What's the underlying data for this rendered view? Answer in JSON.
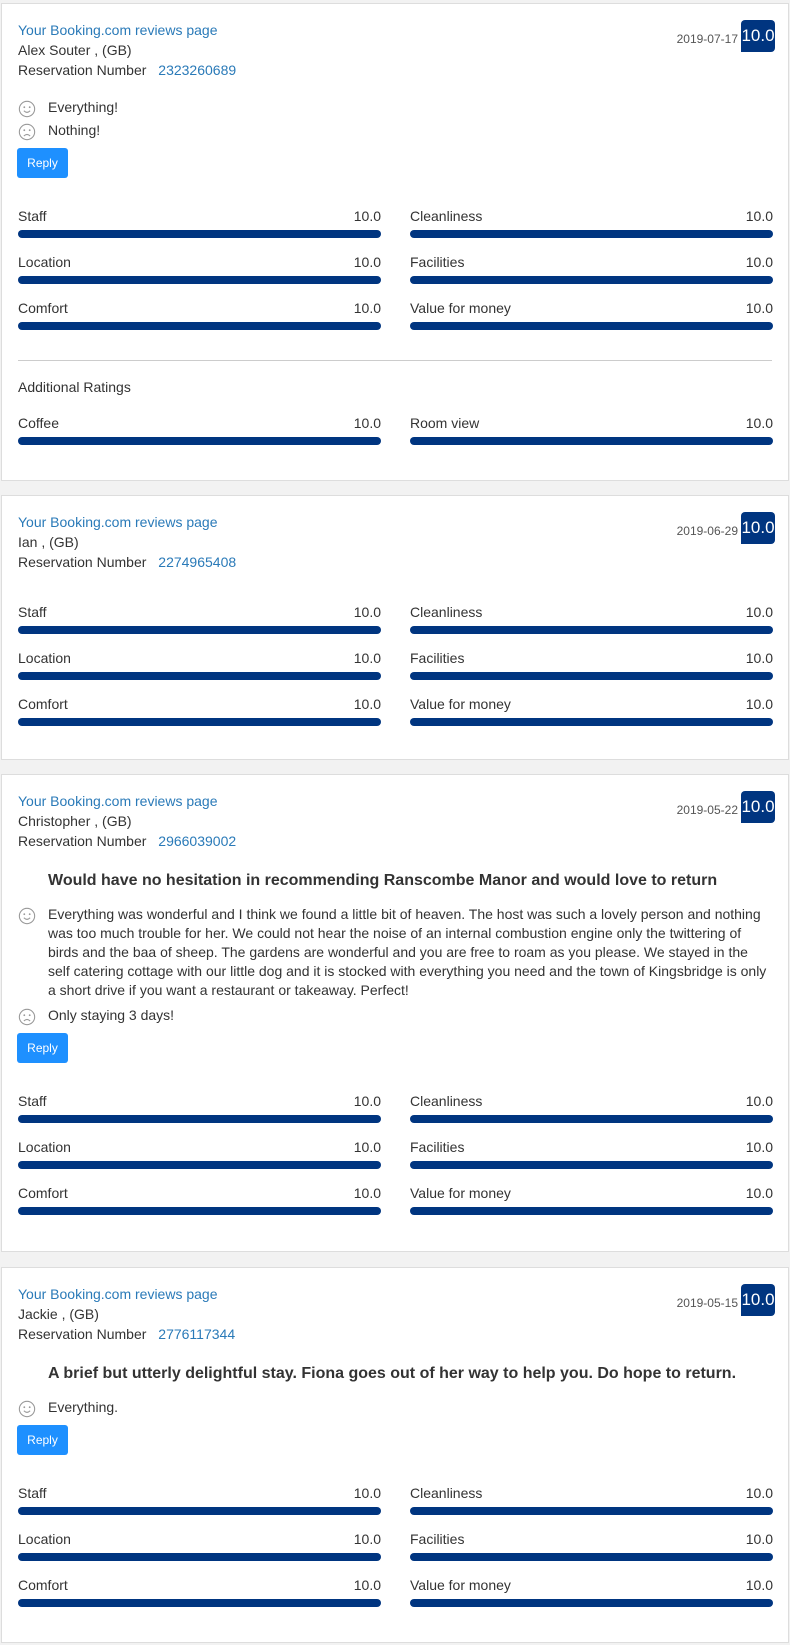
{
  "reviews_page_link": "Your Booking.com reviews page",
  "reservation_label": "Reservation Number",
  "reply_label": "Reply",
  "additional_ratings_title": "Additional Ratings",
  "colors": {
    "score_bg": "#003580",
    "bar_fill": "#003580",
    "link": "#2a7ab8",
    "reply_button": "#1e90ff"
  },
  "icons": {
    "positive": "smile-icon",
    "negative": "frown-icon"
  },
  "reviews": [
    {
      "guest": "Alex Souter , (GB)",
      "reservation_number": "2323260689",
      "date": "2019-07-17",
      "score": "10.0",
      "title": "",
      "positive": "Everything!",
      "negative": "Nothing!",
      "ratings": [
        {
          "label": "Staff",
          "value": "10.0",
          "fill_fraction": 1.0
        },
        {
          "label": "Cleanliness",
          "value": "10.0",
          "fill_fraction": 1.0
        },
        {
          "label": "Location",
          "value": "10.0",
          "fill_fraction": 1.0
        },
        {
          "label": "Facilities",
          "value": "10.0",
          "fill_fraction": 1.0
        },
        {
          "label": "Comfort",
          "value": "10.0",
          "fill_fraction": 1.0
        },
        {
          "label": "Value for money",
          "value": "10.0",
          "fill_fraction": 1.0
        }
      ],
      "additional_ratings": [
        {
          "label": "Coffee",
          "value": "10.0",
          "fill_fraction": 1.0
        },
        {
          "label": "Room view",
          "value": "10.0",
          "fill_fraction": 1.0
        }
      ]
    },
    {
      "guest": "Ian , (GB)",
      "reservation_number": "2274965408",
      "date": "2019-06-29",
      "score": "10.0",
      "title": "",
      "ratings": [
        {
          "label": "Staff",
          "value": "10.0",
          "fill_fraction": 1.0
        },
        {
          "label": "Cleanliness",
          "value": "10.0",
          "fill_fraction": 1.0
        },
        {
          "label": "Location",
          "value": "10.0",
          "fill_fraction": 1.0
        },
        {
          "label": "Facilities",
          "value": "10.0",
          "fill_fraction": 1.0
        },
        {
          "label": "Comfort",
          "value": "10.0",
          "fill_fraction": 1.0
        },
        {
          "label": "Value for money",
          "value": "10.0",
          "fill_fraction": 1.0
        }
      ]
    },
    {
      "guest": "Christopher , (GB)",
      "reservation_number": "2966039002",
      "date": "2019-05-22",
      "score": "10.0",
      "title": "Would have no hesitation in recommending Ranscombe Manor and would love to return",
      "positive": "Everything was wonderful and I think we found a little bit of heaven. The host was such a lovely person and nothing was too much trouble for her. We could not hear the noise of an internal combustion engine only the twittering of birds and the baa of sheep. The gardens are wonderful and you are free to roam as you please. We stayed in the self catering cottage with our little dog and it is stocked with everything you need and the town of Kingsbridge is only a short drive if you want a restaurant or takeaway. Perfect!",
      "negative": "Only staying 3 days!",
      "ratings": [
        {
          "label": "Staff",
          "value": "10.0",
          "fill_fraction": 1.0
        },
        {
          "label": "Cleanliness",
          "value": "10.0",
          "fill_fraction": 1.0
        },
        {
          "label": "Location",
          "value": "10.0",
          "fill_fraction": 1.0
        },
        {
          "label": "Facilities",
          "value": "10.0",
          "fill_fraction": 1.0
        },
        {
          "label": "Comfort",
          "value": "10.0",
          "fill_fraction": 1.0
        },
        {
          "label": "Value for money",
          "value": "10.0",
          "fill_fraction": 1.0
        }
      ]
    },
    {
      "guest": "Jackie , (GB)",
      "reservation_number": "2776117344",
      "date": "2019-05-15",
      "score": "10.0",
      "title": "A brief but utterly delightful stay. Fiona goes out of her way to help you. Do hope to return.",
      "positive": "Everything.",
      "ratings": [
        {
          "label": "Staff",
          "value": "10.0",
          "fill_fraction": 1.0
        },
        {
          "label": "Cleanliness",
          "value": "10.0",
          "fill_fraction": 1.0
        },
        {
          "label": "Location",
          "value": "10.0",
          "fill_fraction": 1.0
        },
        {
          "label": "Facilities",
          "value": "10.0",
          "fill_fraction": 1.0
        },
        {
          "label": "Comfort",
          "value": "10.0",
          "fill_fraction": 1.0
        },
        {
          "label": "Value for money",
          "value": "10.0",
          "fill_fraction": 1.0
        }
      ]
    }
  ]
}
